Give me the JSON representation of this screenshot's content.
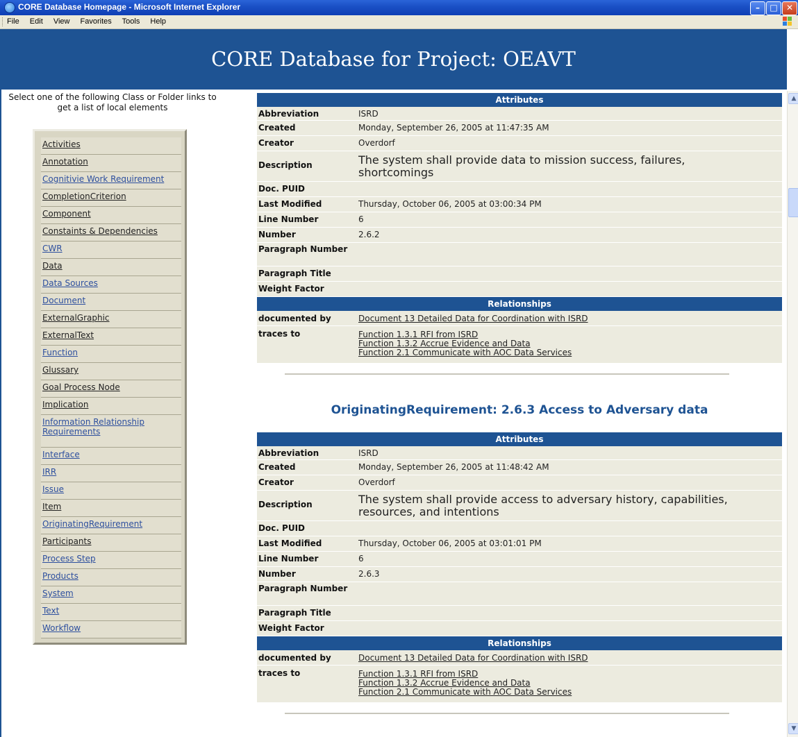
{
  "window": {
    "title": "CORE Database Homepage - Microsoft Internet Explorer",
    "menu": [
      "File",
      "Edit",
      "View",
      "Favorites",
      "Tools",
      "Help"
    ]
  },
  "page": {
    "heading": "CORE Database for Project: OEAVT",
    "intro": "Select one of the following Class or Folder links to get a list of local elements",
    "second_section_title": "OriginatingRequirement: 2.6.3 Access to Adversary data"
  },
  "nav": [
    {
      "label": "Activities",
      "visited": true
    },
    {
      "label": "Annotation",
      "visited": true
    },
    {
      "label": "Cognitivie Work Requirement",
      "visited": false
    },
    {
      "label": "CompletionCriterion",
      "visited": true
    },
    {
      "label": "Component",
      "visited": true
    },
    {
      "label": "Constaints & Dependencies",
      "visited": true
    },
    {
      "label": "CWR",
      "visited": false
    },
    {
      "label": "Data",
      "visited": true
    },
    {
      "label": "Data Sources",
      "visited": false
    },
    {
      "label": "Document",
      "visited": false
    },
    {
      "label": "ExternalGraphic",
      "visited": true
    },
    {
      "label": "ExternalText",
      "visited": true
    },
    {
      "label": "Function",
      "visited": false
    },
    {
      "label": "Glussary",
      "visited": true
    },
    {
      "label": "Goal Process Node",
      "visited": true
    },
    {
      "label": "Implication",
      "visited": true
    },
    {
      "label": "Information Relationship Requirements",
      "visited": false
    },
    {
      "label": "Interface",
      "visited": false
    },
    {
      "label": "IRR",
      "visited": false
    },
    {
      "label": "Issue",
      "visited": false
    },
    {
      "label": "Item",
      "visited": true
    },
    {
      "label": "OriginatingRequirement",
      "visited": false
    },
    {
      "label": "Participants",
      "visited": true
    },
    {
      "label": "Process Step",
      "visited": false
    },
    {
      "label": "Products",
      "visited": false
    },
    {
      "label": "System",
      "visited": false
    },
    {
      "label": "Text",
      "visited": false
    },
    {
      "label": "Workflow",
      "visited": false
    }
  ],
  "sections": [
    {
      "attributes_header": "Attributes",
      "relationships_header": "Relationships",
      "labels": {
        "abbreviation": "Abbreviation",
        "created": "Created",
        "creator": "Creator",
        "description": "Description",
        "doc_puid": "Doc. PUID",
        "last_modified": "Last Modified",
        "line_number": "Line Number",
        "number": "Number",
        "paragraph_number": "Paragraph Number",
        "paragraph_title": "Paragraph Title",
        "weight_factor": "Weight Factor",
        "documented_by": "documented by",
        "traces_to": "traces to"
      },
      "values": {
        "abbreviation": "ISRD",
        "created": "Monday, September 26, 2005 at 11:47:35 AM",
        "creator": "Overdorf",
        "description": "The system shall provide data to mission success, failures, shortcomings",
        "doc_puid": "",
        "last_modified": "Thursday, October 06, 2005 at 03:00:34 PM",
        "line_number": "6",
        "number": "2.6.2",
        "paragraph_number": "",
        "paragraph_title": "",
        "weight_factor": ""
      },
      "documented_by": "Document 13 Detailed Data for Coordination with ISRD",
      "traces_to": [
        "Function 1.3.1 RFI from ISRD",
        "Function 1.3.2 Accrue Evidence and Data",
        "Function 2.1 Communicate with AOC Data Services"
      ]
    },
    {
      "attributes_header": "Attributes",
      "relationships_header": "Relationships",
      "labels": {
        "abbreviation": "Abbreviation",
        "created": "Created",
        "creator": "Creator",
        "description": "Description",
        "doc_puid": "Doc. PUID",
        "last_modified": "Last Modified",
        "line_number": "Line Number",
        "number": "Number",
        "paragraph_number": "Paragraph Number",
        "paragraph_title": "Paragraph Title",
        "weight_factor": "Weight Factor",
        "documented_by": "documented by",
        "traces_to": "traces to"
      },
      "values": {
        "abbreviation": "ISRD",
        "created": "Monday, September 26, 2005 at 11:48:42 AM",
        "creator": "Overdorf",
        "description": "The system shall provide access to adversary history, capabilities, resources, and intentions",
        "doc_puid": "",
        "last_modified": "Thursday, October 06, 2005 at 03:01:01 PM",
        "line_number": "6",
        "number": "2.6.3",
        "paragraph_number": "",
        "paragraph_title": "",
        "weight_factor": ""
      },
      "documented_by": "Document 13 Detailed Data for Coordination with ISRD",
      "traces_to": [
        "Function 1.3.1 RFI from ISRD",
        "Function 1.3.2 Accrue Evidence and Data",
        "Function 2.1 Communicate with AOC Data Services"
      ]
    }
  ]
}
